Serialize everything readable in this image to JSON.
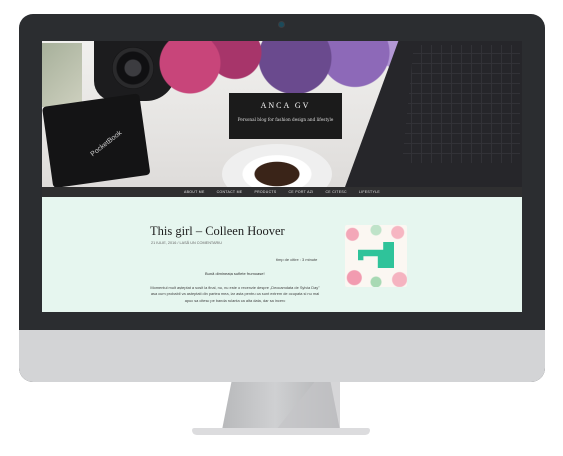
{
  "site": {
    "title": "ANCA GV",
    "description": "Personal blog for fashion design and lifestyle",
    "photo_label": "PocketBook"
  },
  "nav": {
    "items": [
      "ABOUT ME",
      "CONTACT ME",
      "PRODUCTS",
      "CE PORT AZI",
      "CE CITESC",
      "LIFESTYLE"
    ]
  },
  "post": {
    "title": "This girl – Colleen Hoover",
    "meta": "21 IULIE, 2016 / LASĂ UN COMENTARIU",
    "reading_time": "timp de citire : 3 minute",
    "greeting": "Bună dimineața suflete frumoase!",
    "paragraph": "Momentul mult așteptat a sosit la final, nu, nu este o recenzie despre „Deocamdata de Sylvia Day\" asa cum probabil va asteptati din partea mea, iar asta pentru ca sunt extrem de ocupata si nu mai apuc sa citesc pe banda rulanta ca alta data, dar sa incerc"
  },
  "colors": {
    "content_bg": "#e6f6ef",
    "nav_bg": "#2f2f30",
    "title_box_bg": "#1b1b1b",
    "monitor_frame": "#2b2d30",
    "monitor_chin": "#d3d4d6",
    "accent_machine": "#2fc39a"
  }
}
